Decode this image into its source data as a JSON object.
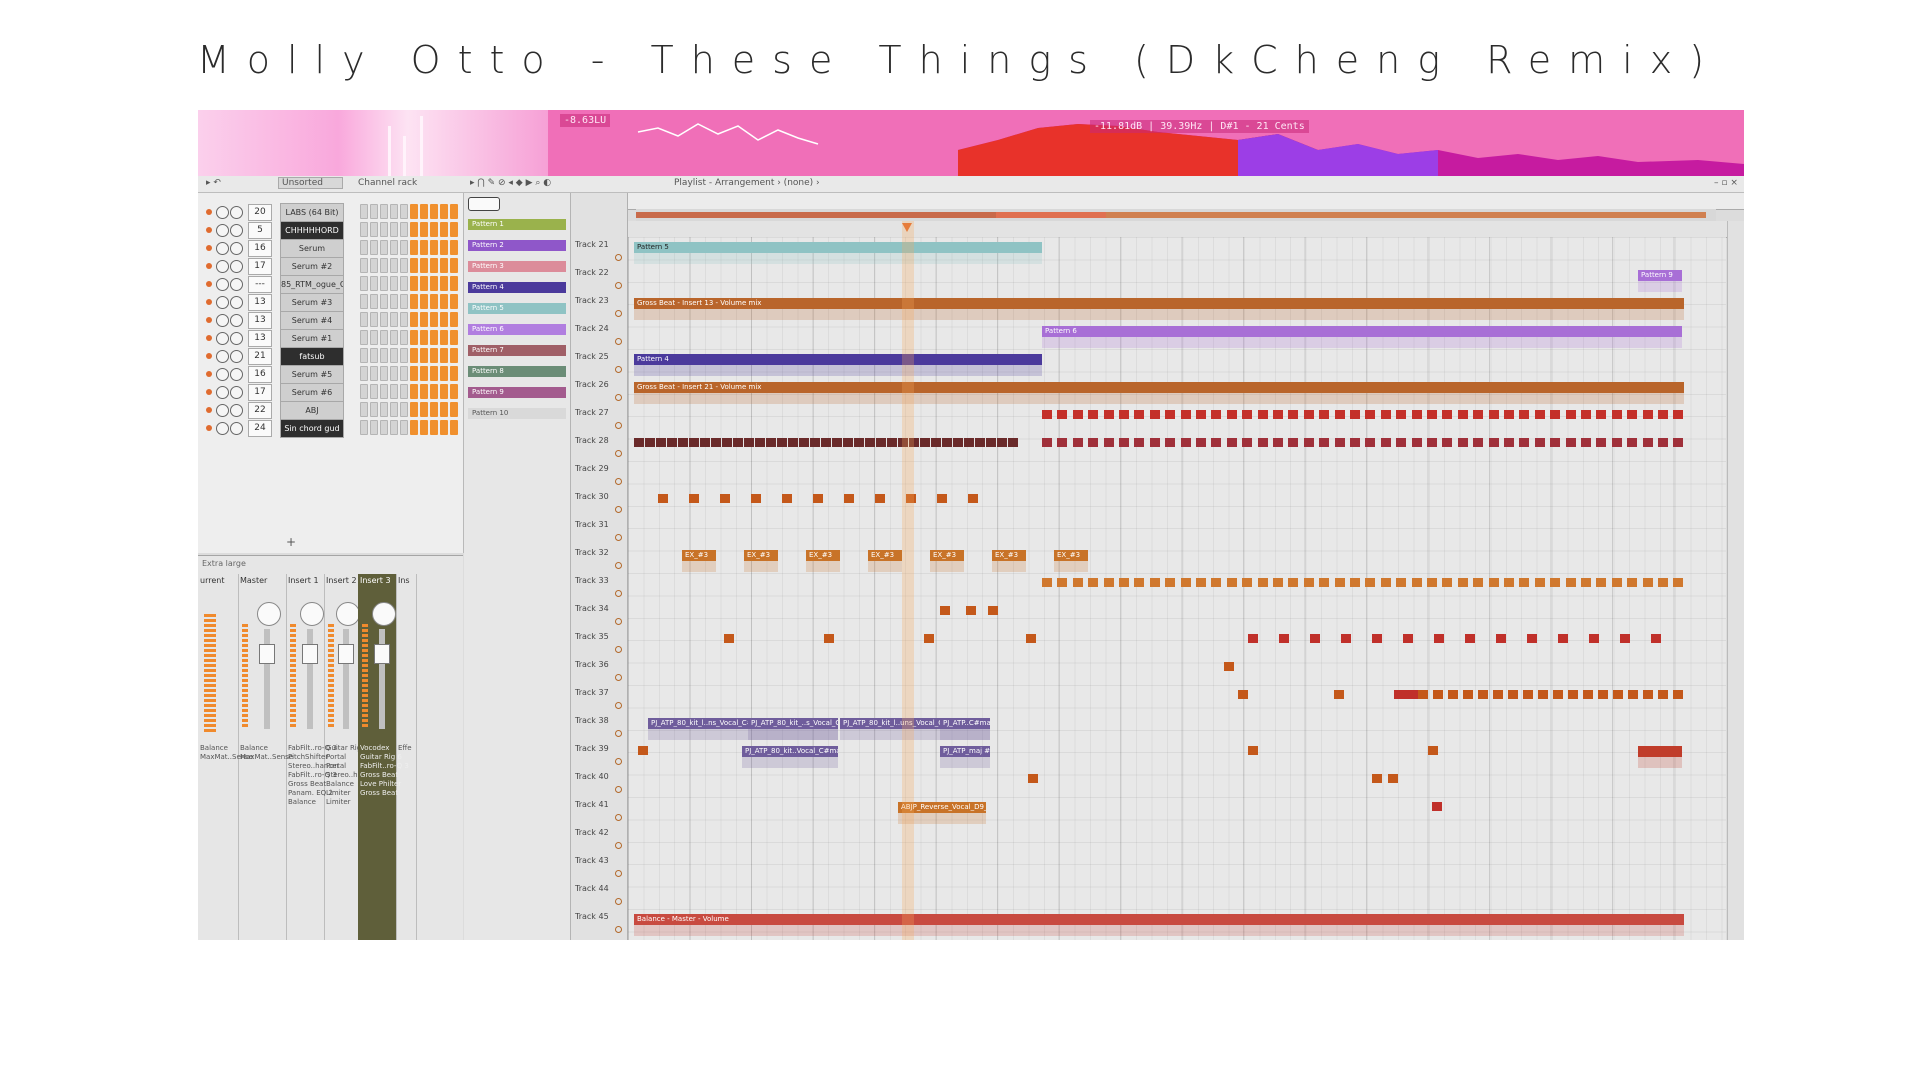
{
  "video_title": "Molly Otto - These Things (DkCheng Remix)",
  "visualizer": {
    "loudness": "-8.63LU",
    "freq_readout": "-11.81dB | 39.39Hz | D#1 - 21 Cents"
  },
  "toolbar": {
    "browser_filter": "Unsorted",
    "channel_rack_title": "Channel rack",
    "playlist_title": "Playlist - Arrangement › (none) ›"
  },
  "channels": [
    {
      "num": "20",
      "name": "LABS (64 Bit)",
      "dark": false
    },
    {
      "num": "5",
      "name": "CHHHHHORD",
      "dark": true
    },
    {
      "num": "16",
      "name": "Serum",
      "dark": false
    },
    {
      "num": "17",
      "name": "Serum #2",
      "dark": false
    },
    {
      "num": "---",
      "name": "85_RTM_ogue_C",
      "dark": false
    },
    {
      "num": "13",
      "name": "Serum #3",
      "dark": false
    },
    {
      "num": "13",
      "name": "Serum #4",
      "dark": false
    },
    {
      "num": "13",
      "name": "Serum #1",
      "dark": false
    },
    {
      "num": "21",
      "name": "fatsub",
      "dark": true
    },
    {
      "num": "16",
      "name": "Serum #5",
      "dark": false
    },
    {
      "num": "17",
      "name": "Serum #6",
      "dark": false
    },
    {
      "num": "22",
      "name": "ABJ",
      "dark": false
    },
    {
      "num": "24",
      "name": "Sin chord gud",
      "dark": true
    }
  ],
  "patterns": [
    {
      "name": "Pattern 1",
      "color": "#9ab24c"
    },
    {
      "name": "Pattern 2",
      "color": "#8f57c9"
    },
    {
      "name": "Pattern 3",
      "color": "#dc8c9a"
    },
    {
      "name": "Pattern 4",
      "color": "#4b3a9c"
    },
    {
      "name": "Pattern 5",
      "color": "#8fc3c4"
    },
    {
      "name": "Pattern 6",
      "color": "#b17ee0"
    },
    {
      "name": "Pattern 7",
      "color": "#a05f67"
    },
    {
      "name": "Pattern 8",
      "color": "#6b8d77"
    },
    {
      "name": "Pattern 9",
      "color": "#a35b8e"
    },
    {
      "name": "Pattern 10",
      "color": "#d9d9d9"
    }
  ],
  "mixer": {
    "view_label": "Extra large",
    "strips": [
      {
        "label": "urrent",
        "fx": "Balance\nMaxMat..Sense"
      },
      {
        "label": "Master",
        "fx": "Balance\nMaxMat..Sense"
      },
      {
        "label": "Insert 1",
        "fx": "FabFilt..ro-Q 3\nPitchShifter\nStereo..hancer\nFabFilt..ro-Q 3\nGross Beat\nPanam. EQ 2\nBalance"
      },
      {
        "label": "Insert 2",
        "fx": "Guitar Rig 6\nPortal\nPortal\nStereo..hancer\nBalance\nLimiter\nLimiter"
      },
      {
        "label": "Insert 3",
        "fx": "Vocodex\nGuitar Rig 6\nFabFilt..ro-Q 3\nGross Beat\nLove Philter\nGross Beat"
      },
      {
        "label": "Ins",
        "fx": "Effe"
      }
    ]
  },
  "tracks": [
    "Track 21",
    "Track 22",
    "Track 23",
    "Track 24",
    "Track 25",
    "Track 26",
    "Track 27",
    "Track 28",
    "Track 29",
    "Track 30",
    "Track 31",
    "Track 32",
    "Track 33",
    "Track 34",
    "Track 35",
    "Track 36",
    "Track 37",
    "Track 38",
    "Track 39",
    "Track 40",
    "Track 41",
    "Track 42",
    "Track 43",
    "Track 44",
    "Track 45"
  ],
  "clips": {
    "pattern5": "Pattern 5",
    "pattern9": "Pattern 9",
    "gross_beat_13": "Gross Beat - Insert 13 - Volume mix",
    "pattern6": "Pattern 6",
    "pattern4": "Pattern 4",
    "gross_beat_21": "Gross Beat - Insert 21 - Volume mix",
    "ex": "EX_#3",
    "vocal1": "PJ_ATP_80_kit_l..ns_Vocal_C#ma",
    "vocal2": "PJ_ATP_80_kit_..s_Vocal_C#ma",
    "vocal3": "PJ_ATP_80_kit_l..uns_Vocal_C#maj",
    "vocal4": "PJ_ATP..C#maj",
    "vocal5": "PJ_ATP_80_kit..Vocal_C#maj #2",
    "vocal6": "PJ_ATP_maj #2",
    "reverse": "ABJP_Reverse_Vocal_D9_8",
    "balance": "Balance - Master - Volume"
  },
  "colors": {
    "viz_bg": "#f06fb8",
    "orange": "#c4581a",
    "gross": "#b9652b",
    "purple_dark": "#4b3a9c",
    "purple_light": "#a86fd6",
    "teal": "#8fc3c4",
    "vocal": "#6f5d9c",
    "balance": "#c84a40",
    "ex": "#c87328"
  }
}
